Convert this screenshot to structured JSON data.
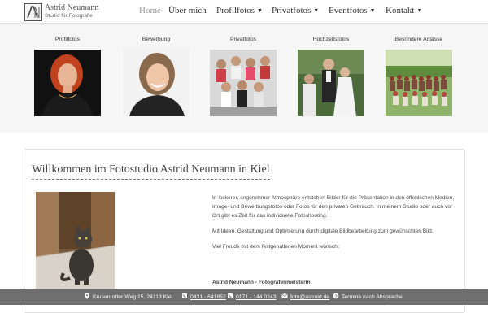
{
  "brand": {
    "name": "Astrid Neumann",
    "subtitle": "Studio für Fotografie"
  },
  "nav": [
    {
      "label": "Home",
      "active": true,
      "dropdown": false
    },
    {
      "label": "Über mich",
      "active": false,
      "dropdown": false
    },
    {
      "label": "Profilfotos",
      "active": false,
      "dropdown": true
    },
    {
      "label": "Privatfotos",
      "active": false,
      "dropdown": true
    },
    {
      "label": "Eventfotos",
      "active": false,
      "dropdown": true
    },
    {
      "label": "Kontakt",
      "active": false,
      "dropdown": true
    }
  ],
  "gallery": [
    {
      "label": "Profilfotos",
      "icon": "portrait-woman-red-hair-photo"
    },
    {
      "label": "Bewerbung",
      "icon": "portrait-woman-smiling-photo"
    },
    {
      "label": "Privatfotos",
      "icon": "group-of-women-photo"
    },
    {
      "label": "Hochzeitsfotos",
      "icon": "wedding-couple-photo"
    },
    {
      "label": "Besondere Anlässe",
      "icon": "large-group-outdoor-photo"
    }
  ],
  "main": {
    "title": "Willkommen im Fotostudio Astrid Neumann in Kiel",
    "paragraphs": [
      "In lockerer, angenehmer Atmosphäre entstehen Bilder für die Präsentation in den öffentlichen Medien, Image- und Bewerbungsfotos oder Fotos für den privaten Gebrauch. In meinem Studio oder auch vor Ort gibt es Zeit für das individuelle Fotoshooting.",
      "Mit Ideen, Gestaltung und Optimierung durch digitale Bildbearbeitung zum gewünschten Bild.",
      "Viel Freude mit dem festgehaltenen Moment wünscht"
    ],
    "signature": "Astrid Neumann - Fotografenmeisterin",
    "photo_icon": "cat-photo"
  },
  "footer": {
    "address": "Krusenrotter Weg 15, 24113 Kiel",
    "phone1": "0431 - 641852",
    "phone2": "0171 - 144 0243",
    "email": "foto@astroid.de",
    "hours": "Termine nach Absprache"
  },
  "colors": {
    "footer_bg": "#6f6f6f",
    "band_bg": "#f6f6f6",
    "nav_active": "#9a9a9a"
  }
}
